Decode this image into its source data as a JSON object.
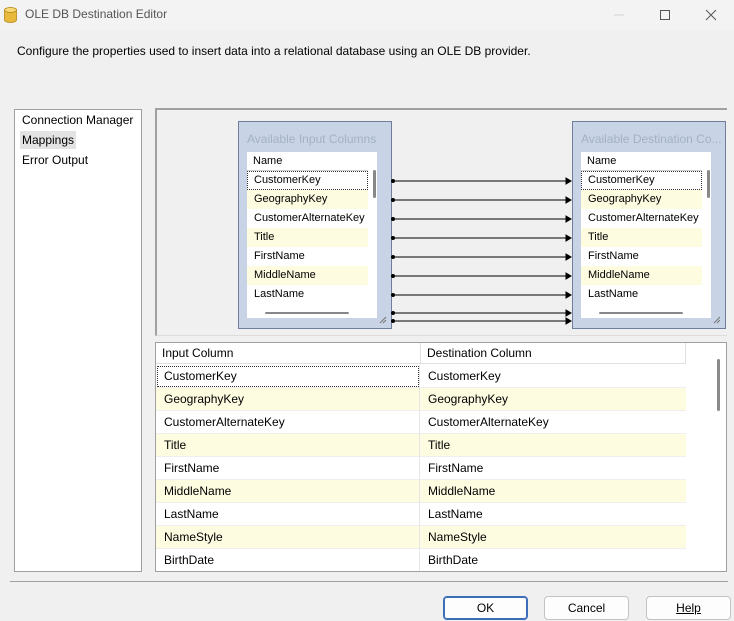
{
  "window": {
    "title": "OLE DB Destination Editor"
  },
  "description": "Configure the properties used to insert data into a relational database using an OLE DB provider.",
  "nav": {
    "items": [
      {
        "label": "Connection Manager",
        "selected": false
      },
      {
        "label": "Mappings",
        "selected": true
      },
      {
        "label": "Error Output",
        "selected": false
      }
    ]
  },
  "input_box": {
    "title": "Available Input Columns",
    "header": "Name",
    "columns": [
      "CustomerKey",
      "GeographyKey",
      "CustomerAlternateKey",
      "Title",
      "FirstName",
      "MiddleName",
      "LastName"
    ]
  },
  "dest_box": {
    "title": "Available Destination Co...",
    "header": "Name",
    "columns": [
      "CustomerKey",
      "GeographyKey",
      "CustomerAlternateKey",
      "Title",
      "FirstName",
      "MiddleName",
      "LastName"
    ]
  },
  "grid": {
    "headers": {
      "input": "Input Column",
      "destination": "Destination Column"
    },
    "rows": [
      {
        "input": "CustomerKey",
        "destination": "CustomerKey"
      },
      {
        "input": "GeographyKey",
        "destination": "GeographyKey"
      },
      {
        "input": "CustomerAlternateKey",
        "destination": "CustomerAlternateKey"
      },
      {
        "input": "Title",
        "destination": "Title"
      },
      {
        "input": "FirstName",
        "destination": "FirstName"
      },
      {
        "input": "MiddleName",
        "destination": "MiddleName"
      },
      {
        "input": "LastName",
        "destination": "LastName"
      },
      {
        "input": "NameStyle",
        "destination": "NameStyle"
      },
      {
        "input": "BirthDate",
        "destination": "BirthDate"
      }
    ]
  },
  "buttons": {
    "ok": "OK",
    "cancel": "Cancel",
    "help": "Help"
  },
  "colors": {
    "alt_row": "#fdfbe0",
    "box_fill": "#c8d4e6",
    "default_button_border": "#3b6eb7"
  }
}
